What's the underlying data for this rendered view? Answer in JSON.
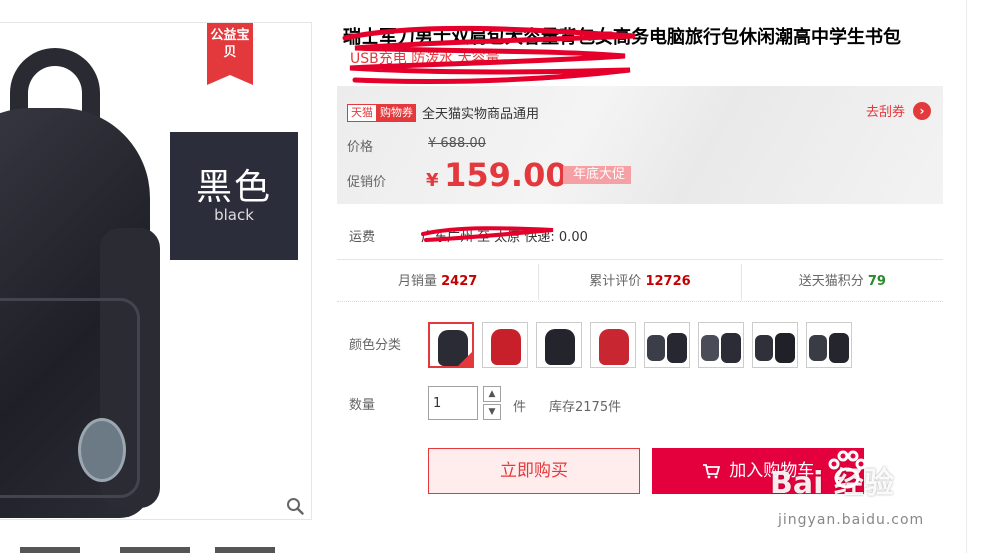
{
  "gallery": {
    "promo_tag": "公益宝贝",
    "color_card": {
      "cn": "黑色",
      "en": "black"
    }
  },
  "product": {
    "title": "瑞士军刀男士双肩包大容量背包女高务电脑旅行包休闲潮高中学生书包",
    "subtitle": "USB充电 防泼水 大容量"
  },
  "price_box": {
    "tmall": "天猫",
    "coupon_tag": "购物券",
    "coupon_text": "全天猫实物商品通用",
    "get_coupon": "去刮券",
    "price_label": "价格",
    "original_price": "¥ 688.00",
    "promo_label": "促销价",
    "currency": "¥",
    "promo_price": "159.00",
    "promo_badge": "年底大促"
  },
  "shipping": {
    "label": "运费",
    "value": "广东广州 至 太原 快递: 0.00"
  },
  "stats": [
    {
      "label": "月销量",
      "value": "2427",
      "color": "#c40000"
    },
    {
      "label": "累计评价",
      "value": "12726",
      "color": "#c40000"
    },
    {
      "label": "送天猫积分",
      "value": "79",
      "color": "#2a8a2a"
    }
  ],
  "colors": {
    "label": "颜色分类",
    "swatches": [
      "black",
      "red",
      "black",
      "red",
      "grey",
      "grey",
      "grey",
      "grey"
    ],
    "selected": 0
  },
  "quantity": {
    "label": "数量",
    "value": "1",
    "unit": "件",
    "stock": "库存2175件"
  },
  "actions": {
    "buy_now": "立即购买",
    "add_cart": "加入购物车"
  },
  "watermark": {
    "text": "Bai  经验",
    "url": "jingyan.baidu.com"
  },
  "accent": "#e4393c"
}
